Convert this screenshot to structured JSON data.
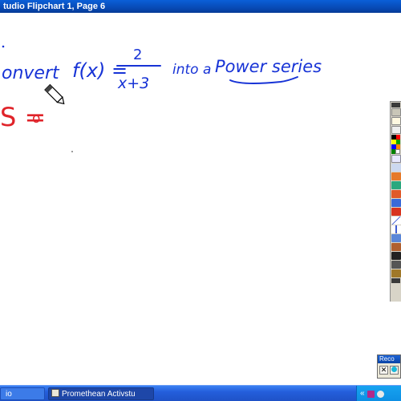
{
  "window": {
    "title": "tudio  Flipchart 1, Page 6"
  },
  "canvas": {
    "handwriting": {
      "prefix": "onvert",
      "function_name": "f(x) =",
      "numerator": "2",
      "denominator": "x+3",
      "middle": "into a",
      "target": "Power series",
      "red_symbol": "S =",
      "trailing_mark": "o"
    },
    "colors": {
      "blue_ink": "#1733d6",
      "red_ink": "#e0242a"
    }
  },
  "palette": {
    "swatches": [
      "#000000",
      "#ff0000",
      "#ffff00",
      "#00a000",
      "#0000ff",
      "#ff8000",
      "#008000",
      "#ffffff"
    ]
  },
  "recorder": {
    "title": "Reco",
    "stop_icon": "close-icon",
    "record_icon": "record-icon"
  },
  "taskbar": {
    "left_item": "io",
    "main_item": "Promethean Activstu",
    "tray_chevron": "«"
  }
}
